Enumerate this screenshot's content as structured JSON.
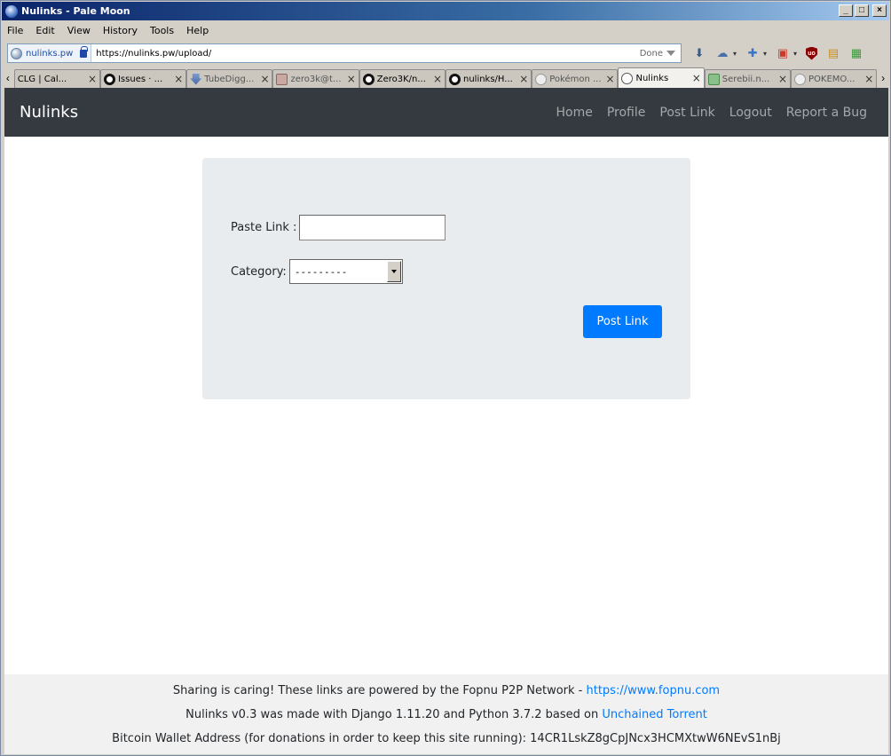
{
  "window": {
    "title": "Nulinks - Pale Moon",
    "min": "_",
    "max": "□",
    "close": "×"
  },
  "menu": [
    "File",
    "Edit",
    "View",
    "History",
    "Tools",
    "Help"
  ],
  "urlbar": {
    "identity": "nulinks.pw",
    "url": "https://nulinks.pw/upload/",
    "status": "Done"
  },
  "tabs": [
    {
      "label": "CLG | Cal...",
      "close": "×"
    },
    {
      "label": "Issues · ...",
      "close": "×"
    },
    {
      "label": "TubeDigg...",
      "close": "×"
    },
    {
      "label": "zero3k@t...",
      "close": "×"
    },
    {
      "label": "Zero3K/n...",
      "close": "×"
    },
    {
      "label": "nulinks/H...",
      "close": "×"
    },
    {
      "label": "Pokémon ...",
      "close": "×"
    },
    {
      "label": "Nulinks",
      "close": "×"
    },
    {
      "label": "Serebii.n...",
      "close": "×"
    },
    {
      "label": "POKEMO...",
      "close": "×"
    }
  ],
  "site": {
    "brand": "Nulinks",
    "nav": [
      "Home",
      "Profile",
      "Post Link",
      "Logout",
      "Report a Bug"
    ]
  },
  "form": {
    "paste_label": "Paste Link :",
    "category_label": "Category:",
    "category_value": "---------",
    "submit": "Post Link"
  },
  "footer": {
    "line1": "Sharing is caring! These links are powered by the Fopnu P2P Network - ",
    "line1_link": "https://www.fopnu.com",
    "line2": "Nulinks v0.3 was made with Django 1.11.20 and Python 3.7.2 based on ",
    "line2_link": "Unchained Torrent",
    "line3": "Bitcoin Wallet Address (for donations in order to keep this site running): 14CR1LskZ8gCpJNcx3HCMXtwW6NEvS1nBj"
  }
}
